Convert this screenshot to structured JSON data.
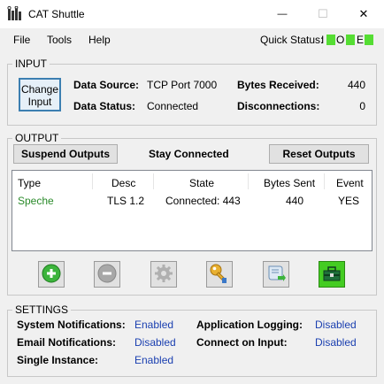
{
  "window": {
    "title": "CAT Shuttle",
    "controls": {
      "minimize": "—",
      "maximize": "☐",
      "close": "✕"
    }
  },
  "menu": {
    "items": [
      "File",
      "Tools",
      "Help"
    ],
    "quick_status": {
      "label": "Quick Status:",
      "indicators": [
        {
          "letter": "I",
          "color": "#55dd33"
        },
        {
          "letter": "O",
          "color": "#55dd33"
        },
        {
          "letter": "E",
          "color": "#55dd33"
        }
      ]
    }
  },
  "input": {
    "group_title": "INPUT",
    "change_button": "Change Input",
    "data_source_label": "Data Source:",
    "data_source_value": "TCP Port 7000",
    "data_status_label": "Data Status:",
    "data_status_value": "Connected",
    "bytes_received_label": "Bytes Received:",
    "bytes_received_value": "440",
    "disconnections_label": "Disconnections:",
    "disconnections_value": "0"
  },
  "output": {
    "group_title": "OUTPUT",
    "suspend_button": "Suspend Outputs",
    "stay_connected": "Stay Connected",
    "reset_button": "Reset Outputs",
    "columns": [
      "Type",
      "Desc",
      "State",
      "Bytes Sent",
      "Event"
    ],
    "rows": [
      {
        "type": "Speche",
        "desc": "TLS 1.2",
        "state": "Connected: 443",
        "bytes_sent": "440",
        "event": "YES"
      }
    ],
    "toolbar": [
      {
        "name": "add-icon",
        "enabled": true
      },
      {
        "name": "remove-icon",
        "enabled": false
      },
      {
        "name": "gear-icon",
        "enabled": false
      },
      {
        "name": "key-icon",
        "enabled": true
      },
      {
        "name": "export-script-icon",
        "enabled": true
      },
      {
        "name": "toolbox-icon",
        "enabled": true,
        "color": "#44cc22"
      }
    ]
  },
  "settings": {
    "group_title": "SETTINGS",
    "system_notifications_label": "System Notifications:",
    "system_notifications_value": "Enabled",
    "email_notifications_label": "Email Notifications:",
    "email_notifications_value": "Disabled",
    "single_instance_label": "Single Instance:",
    "single_instance_value": "Enabled",
    "app_logging_label": "Application Logging:",
    "app_logging_value": "Disabled",
    "connect_on_input_label": "Connect on Input:",
    "connect_on_input_value": "Disabled"
  },
  "colors": {
    "accent_blue": "#1a3fb0",
    "status_green": "#55dd33",
    "row_type_green": "#2a8a2a"
  }
}
